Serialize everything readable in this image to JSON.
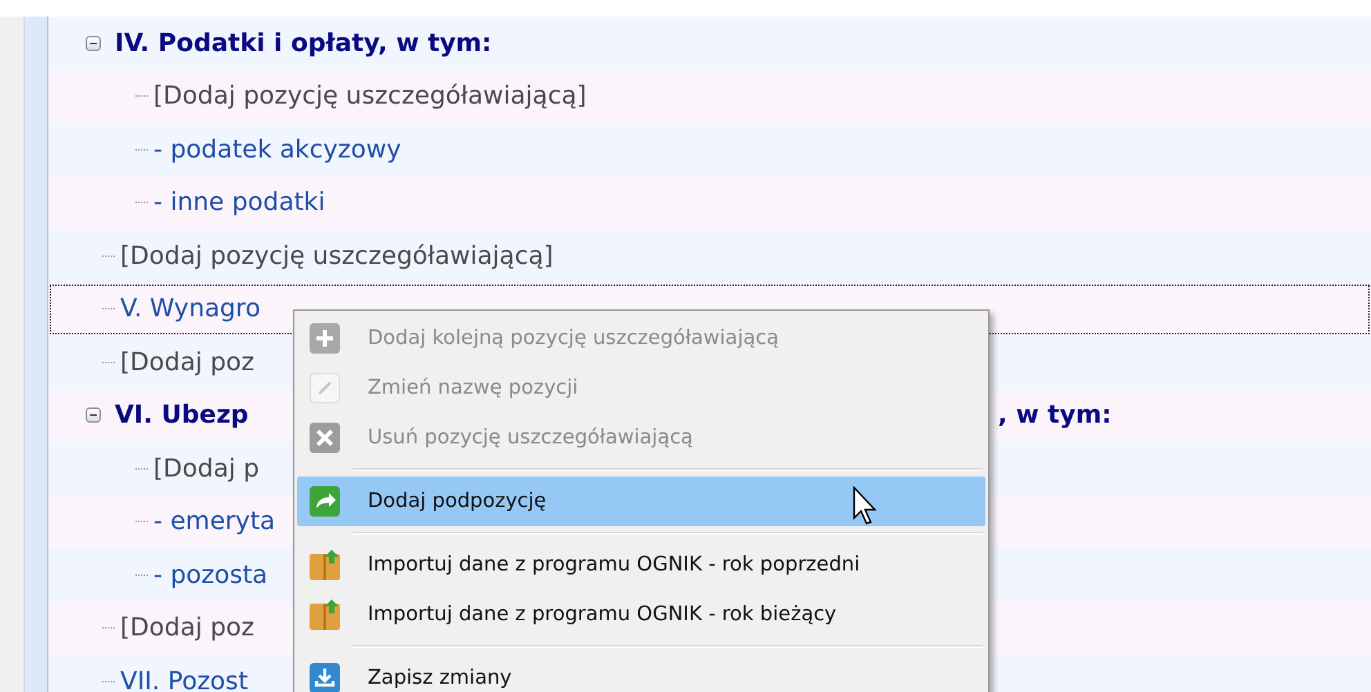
{
  "tree": {
    "nodes": [
      {
        "kind": "group",
        "label": "IV. Podatki i opłaty, w tym:",
        "expanded": true,
        "selected": false,
        "children": [
          {
            "kind": "add",
            "label": "[Dodaj pozycję uszczegóławiającą]",
            "selected": false
          },
          {
            "kind": "item",
            "label": "- podatek akcyzowy",
            "selected": false
          },
          {
            "kind": "item",
            "label": "- inne podatki",
            "selected": false
          }
        ]
      },
      {
        "kind": "add",
        "label": "[Dodaj pozycję uszczegóławiającą]",
        "selected": false
      },
      {
        "kind": "item",
        "label": "V. Wynagro",
        "selected": true
      },
      {
        "kind": "add",
        "label": "[Dodaj poz",
        "selected": false
      },
      {
        "kind": "group",
        "label": "VI. Ubezp",
        "tail": ", w tym:",
        "expanded": true,
        "selected": false,
        "children": [
          {
            "kind": "add",
            "label": "[Dodaj p",
            "selected": false
          },
          {
            "kind": "item",
            "label": "- emeryta",
            "selected": false
          },
          {
            "kind": "item",
            "label": "- pozosta",
            "selected": false
          }
        ]
      },
      {
        "kind": "add",
        "label": "[Dodaj poz",
        "selected": false
      },
      {
        "kind": "item",
        "label": "VII. Pozost",
        "selected": false
      }
    ]
  },
  "context_menu": {
    "items": [
      {
        "kind": "item",
        "label": "Dodaj kolejną pozycję uszczegóławiającą",
        "disabled": true,
        "selected": false
      },
      {
        "kind": "item",
        "label": "Zmień nazwę pozycji",
        "disabled": true,
        "selected": false
      },
      {
        "kind": "item",
        "label": "Usuń pozycję uszczegóławiającą",
        "disabled": true,
        "selected": false
      },
      {
        "kind": "separator"
      },
      {
        "kind": "item",
        "label": "Dodaj podpozycję",
        "disabled": false,
        "selected": true
      },
      {
        "kind": "separator"
      },
      {
        "kind": "item",
        "label": "Importuj dane z programu OGNIK - rok poprzedni",
        "disabled": false,
        "selected": false
      },
      {
        "kind": "item",
        "label": "Importuj dane z programu OGNIK - rok bieżący",
        "disabled": false,
        "selected": false
      },
      {
        "kind": "separator"
      },
      {
        "kind": "item",
        "label": "Zapisz zmiany",
        "disabled": false,
        "selected": false
      }
    ]
  }
}
